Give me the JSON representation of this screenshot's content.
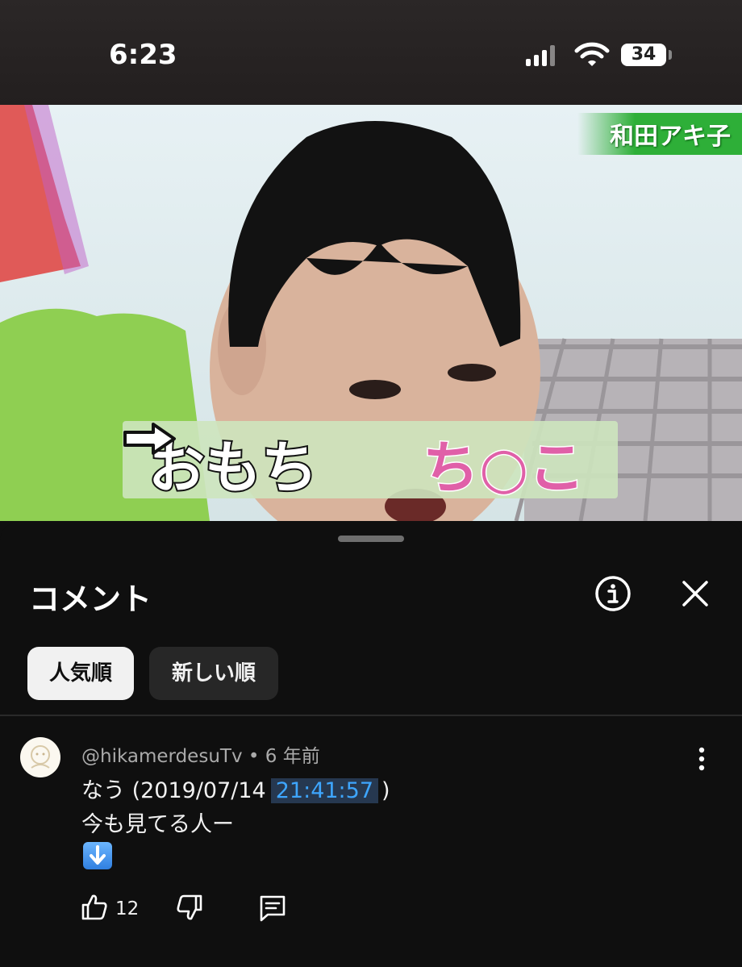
{
  "status_bar": {
    "time": "6:23",
    "battery": "34"
  },
  "video": {
    "name_tag": "和田アキ子",
    "caption_left": "おもち",
    "caption_right": "ち○こ",
    "colors": {
      "tag_green": "#2eaf38",
      "caption_pink": "#e060a8"
    }
  },
  "comments_panel": {
    "title": "コメント",
    "icons": [
      "info-icon",
      "close-icon"
    ],
    "sort_chips": [
      {
        "label": "人気順",
        "selected": true
      },
      {
        "label": "新しい順",
        "selected": false
      }
    ],
    "comment": {
      "author": "@hikamerdesuTv",
      "age": "6 年前",
      "text_prefix": "なう (2019/07/14",
      "timestamp": "21:41:57",
      "text_suffix": ")",
      "line2": "今も見てる人ー",
      "emoji": "⬇️",
      "likes": "12"
    },
    "colors": {
      "link_blue": "#3ea6ff",
      "background": "#0f0f0f"
    }
  }
}
